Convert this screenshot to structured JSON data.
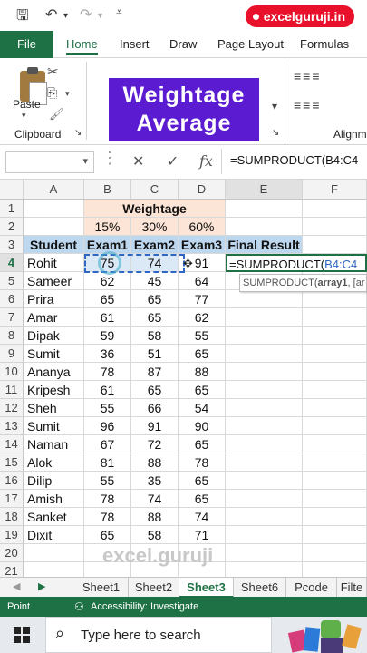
{
  "titlebar": {
    "save_icon": "save-icon",
    "undo_icon": "undo-icon",
    "redo_icon": "redo-icon",
    "brand": "excelguruji.in"
  },
  "tabs": [
    "File",
    "Home",
    "Insert",
    "Draw",
    "Page Layout",
    "Formulas"
  ],
  "active_tab": "Home",
  "ribbon": {
    "paste": "Paste",
    "clipboard": "Clipboard",
    "alignment": "Alignme"
  },
  "overlay_title": {
    "line1": "Weightage",
    "line2": "Average"
  },
  "formula_bar": {
    "cancel": "✕",
    "enter": "✓",
    "fx": "fx",
    "formula": "=SUMPRODUCT(B4:C4"
  },
  "columns": [
    "A",
    "B",
    "C",
    "D",
    "E",
    "F"
  ],
  "rows": [
    "1",
    "2",
    "3",
    "4",
    "5",
    "6",
    "7",
    "8",
    "9",
    "10",
    "11",
    "12",
    "13",
    "14",
    "15",
    "16",
    "17",
    "18",
    "19",
    "20",
    "21"
  ],
  "sheet": {
    "weightage_title": "Weightage",
    "weights": [
      "15%",
      "30%",
      "60%"
    ],
    "headers": [
      "Student",
      "Exam1",
      "Exam2",
      "Exam3",
      "Final Result"
    ],
    "students": [
      {
        "name": "Rohit",
        "e1": "75",
        "e2": "74",
        "e3": "91"
      },
      {
        "name": "Sameer",
        "e1": "62",
        "e2": "45",
        "e3": "64"
      },
      {
        "name": "Prira",
        "e1": "65",
        "e2": "65",
        "e3": "77"
      },
      {
        "name": "Amar",
        "e1": "61",
        "e2": "65",
        "e3": "62"
      },
      {
        "name": "Dipak",
        "e1": "59",
        "e2": "58",
        "e3": "55"
      },
      {
        "name": "Sumit",
        "e1": "36",
        "e2": "51",
        "e3": "65"
      },
      {
        "name": "Ananya",
        "e1": "78",
        "e2": "87",
        "e3": "88"
      },
      {
        "name": "Kripesh",
        "e1": "61",
        "e2": "65",
        "e3": "65"
      },
      {
        "name": "Sheh",
        "e1": "55",
        "e2": "66",
        "e3": "54"
      },
      {
        "name": "Sumit",
        "e1": "96",
        "e2": "91",
        "e3": "90"
      },
      {
        "name": "Naman",
        "e1": "67",
        "e2": "72",
        "e3": "65"
      },
      {
        "name": "Alok",
        "e1": "81",
        "e2": "88",
        "e3": "78"
      },
      {
        "name": "Dilip",
        "e1": "55",
        "e2": "35",
        "e3": "65"
      },
      {
        "name": "Amish",
        "e1": "78",
        "e2": "74",
        "e3": "65"
      },
      {
        "name": "Sanket",
        "e1": "78",
        "e2": "88",
        "e3": "74"
      },
      {
        "name": "Dixit",
        "e1": "65",
        "e2": "58",
        "e3": "71"
      }
    ],
    "editing_formula": "=SUMPRODUCT(",
    "editing_ref": "B4:C4"
  },
  "tooltip": "SUMPRODUCT(array1, [array2], ...)",
  "tooltip_fn": "SUMPRODUCT(",
  "tooltip_arg": "array1",
  "tooltip_rest": ", [ar",
  "watermark": "excel.guruji",
  "sheet_tabs": [
    "Sheet1",
    "Sheet2",
    "Sheet3",
    "Sheet6",
    "Pcode",
    "Filte"
  ],
  "active_sheet": "Sheet3",
  "statusbar": {
    "mode": "Point",
    "accessibility": "Accessibility: Investigate"
  },
  "taskbar": {
    "search_placeholder": "Type here to search"
  },
  "colors": {
    "excel_green": "#1e7145",
    "header_blue": "#bdd7ee",
    "weight_peach": "#fce4d6",
    "brand_red": "#e8102b",
    "overlay_purple": "#5b1bd1"
  }
}
